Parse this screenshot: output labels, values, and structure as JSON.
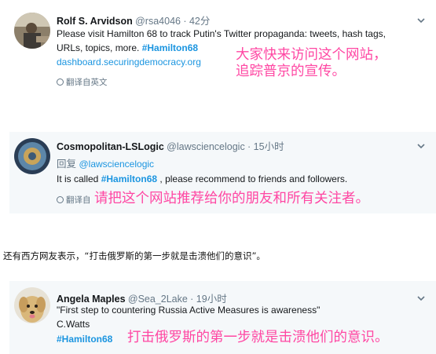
{
  "tweets": [
    {
      "name": "Rolf S. Arvidson",
      "handle": "@rsa4046",
      "time": "· 42分",
      "lines": [
        "Please visit Hamilton 68 to track Putin's Twitter propaganda: tweets, hash tags,",
        "URLs, topics, more. "
      ],
      "hashtag": "#Hamilton68",
      "link": "dashboard.securingdemocracy.org",
      "translate": "翻译自英文",
      "overlay": [
        "大家快来访问这个网站，",
        "追踪普京的宣传。"
      ]
    },
    {
      "name": "Cosmopolitan-LSLogic",
      "handle": "@lawsciencelogic",
      "time": "· 15小时",
      "reply_prefix": "回复 ",
      "reply_to": "@lawsciencelogic",
      "text_before": "It is called ",
      "hashtag": "#Hamilton68",
      "text_after": " , please recommend to friends and followers.",
      "translate": "翻译自",
      "overlay": "请把这个网站推荐给你的朋友和所有关注者。"
    },
    {
      "name": "Angela Maples",
      "handle": "@Sea_2Lake",
      "time": "· 19小时",
      "quote": "\"First step to countering Russia Active Measures is awareness\"",
      "author": "C.Watts",
      "hashtag": "#Hamilton68",
      "overlay": "打击俄罗斯的第一步就是击溃他们的意识。"
    }
  ],
  "caption": "还有西方网友表示，“打击俄罗斯的第一步就是击溃他们的意识”。",
  "colors": {
    "accent": "#1b95e0",
    "overlay": "#ff47a3",
    "tweet_bg": "#f5f8fa"
  }
}
